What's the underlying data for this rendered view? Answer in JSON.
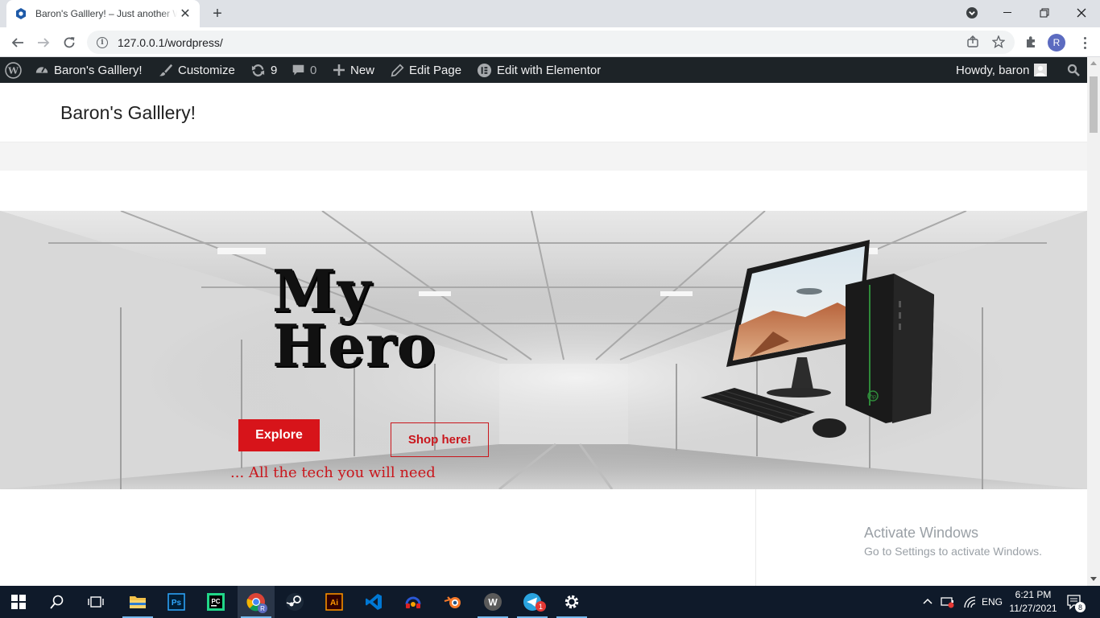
{
  "browser": {
    "tab_title": "Baron's Galllery! – Just another WordPress site",
    "url": "127.0.0.1/wordpress/",
    "profile_initial": "R"
  },
  "adminbar": {
    "site_name": "Baron's Galllery!",
    "customize": "Customize",
    "updates_count": "9",
    "comments_count": "0",
    "new_label": "New",
    "edit_page": "Edit Page",
    "elementor": "Edit with Elementor",
    "howdy": "Howdy, baron"
  },
  "site": {
    "title": "Baron's Galllery!"
  },
  "hero": {
    "title_line1": "My",
    "title_line2": "Hero",
    "explore_label": "Explore",
    "shop_label": "Shop here!",
    "tagline": "... All the tech you will need"
  },
  "watermark": {
    "line1": "Activate Windows",
    "line2": "Go to Settings to activate Windows."
  },
  "taskbar": {
    "lang": "ENG",
    "time": "6:21 PM",
    "date": "11/27/2021",
    "notif_count": "8",
    "telegram_badge": "1",
    "chrome_badge": "R"
  },
  "colors": {
    "adminbar_bg": "#1d2327",
    "accent_red": "#d7141a",
    "taskbar_bg": "#0f1a2a"
  }
}
